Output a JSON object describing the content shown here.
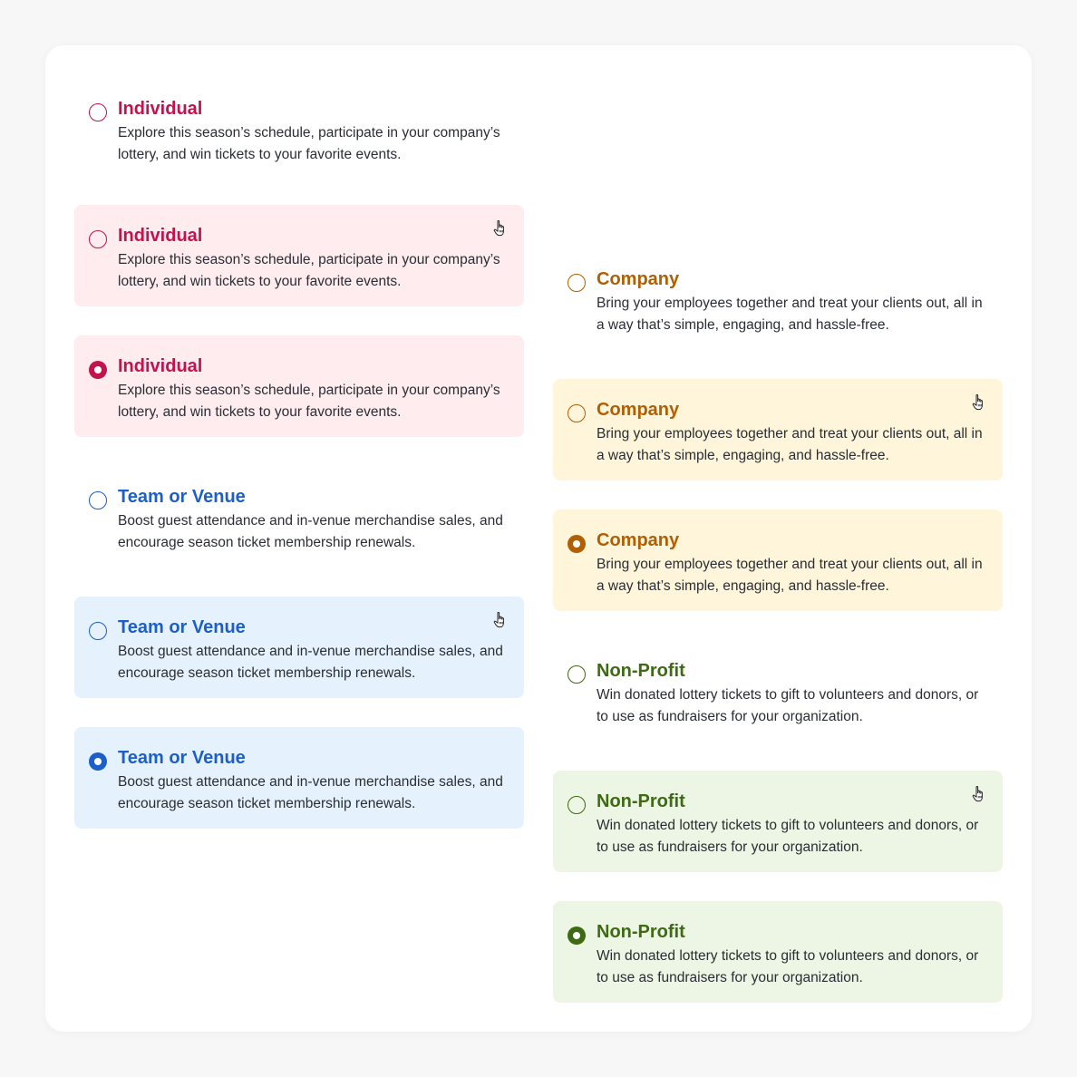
{
  "colors": {
    "individual": "#c2134f",
    "team_venue": "#1c5fc8",
    "company": "#b05f02",
    "non_profit": "#3d6a12"
  },
  "options": {
    "individual": {
      "title": "Individual",
      "description": "Explore this season’s schedule, participate in your company’s lottery, and win tickets to your favorite events."
    },
    "team_venue": {
      "title": "Team or Venue",
      "description": "Boost guest attendance and in-venue merchandise sales, and encourage season ticket membership renewals."
    },
    "company": {
      "title": "Company",
      "description": "Bring your employees together and treat your clients out, all in a way that’s simple, engaging, and hassle-free."
    },
    "non_profit": {
      "title": "Non-Profit",
      "description": "Win donated lottery tickets to gift to volunteers and donors, or to use as fundraisers for your organization."
    }
  },
  "states": [
    "default",
    "hover",
    "selected"
  ],
  "icons": {
    "cursor": "hand-pointer-icon",
    "radio": "radio-button-icon"
  }
}
